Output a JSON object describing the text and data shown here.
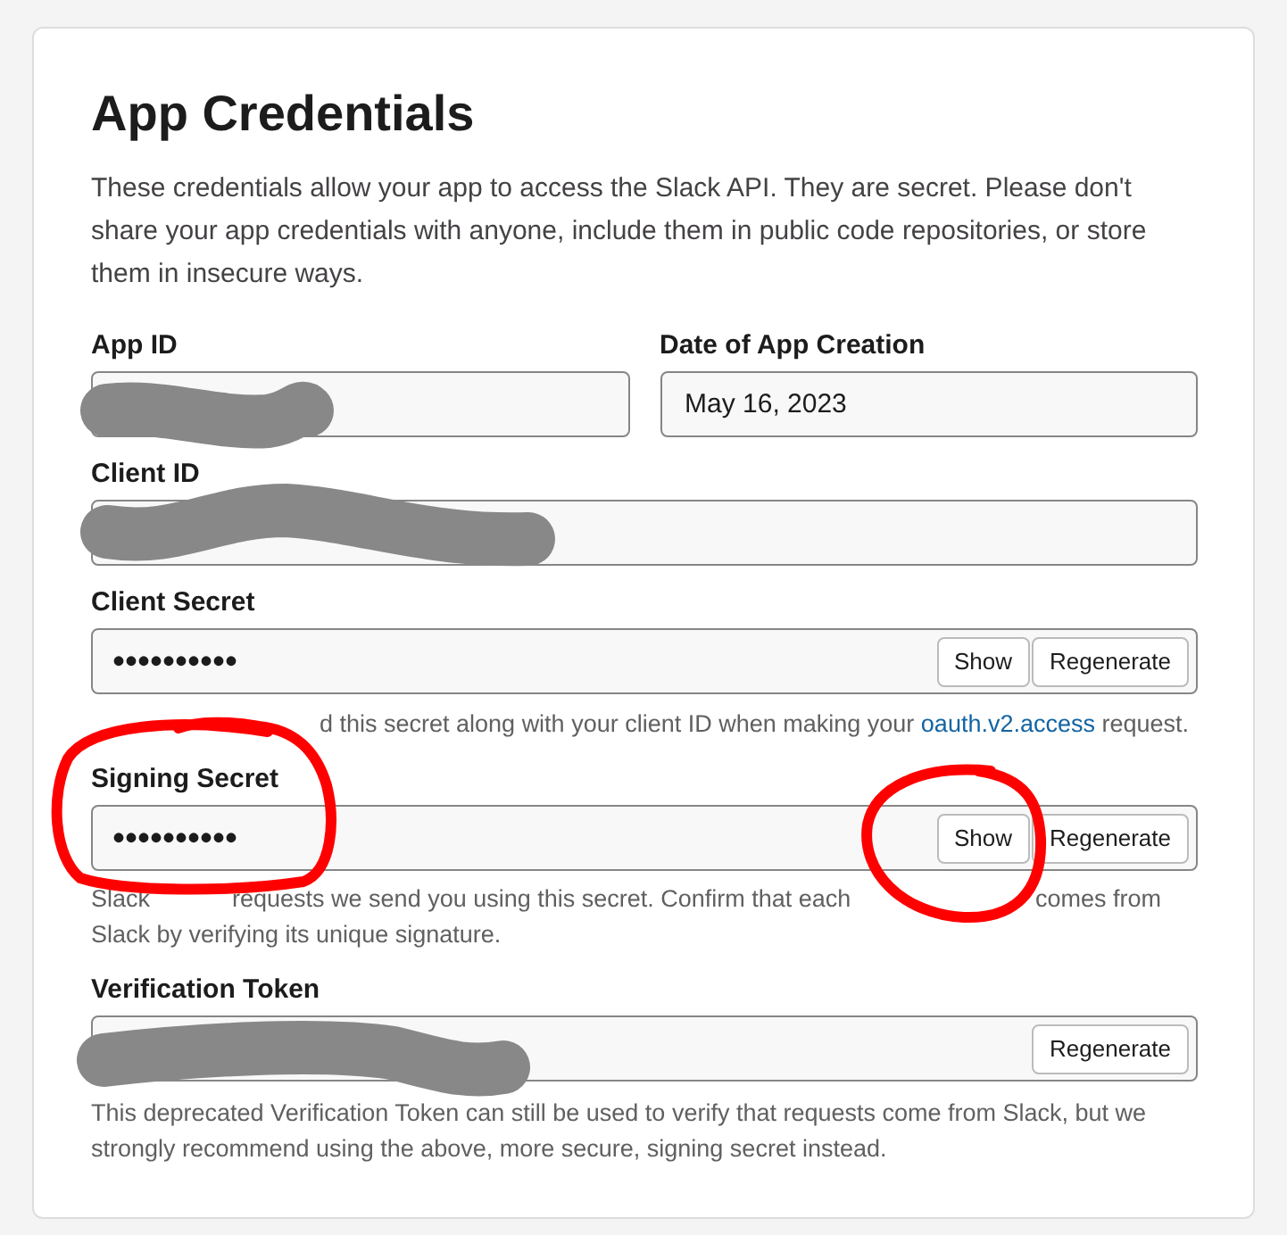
{
  "title": "App Credentials",
  "description": "These credentials allow your app to access the Slack API. They are secret. Please don't share your app credentials with anyone, include them in public code repositories, or store them in insecure ways.",
  "fields": [
    {
      "label": "App ID",
      "kind": "redacted"
    },
    {
      "label": "Date of App Creation",
      "kind": "text",
      "value": "May 16, 2023"
    },
    {
      "label": "Client ID",
      "kind": "redacted"
    },
    {
      "label": "Client Secret",
      "kind": "secret",
      "value": "••••••••••",
      "buttons": [
        "Show",
        "Regenerate"
      ],
      "help": [
        [
          {
            "text": "d this secret along with your client ID when making your ",
            "kind": "text"
          },
          {
            "text": "oauth.v2.access",
            "kind": "link"
          },
          {
            "text": " request.",
            "kind": "text"
          }
        ]
      ]
    },
    {
      "label": "Signing Secret",
      "kind": "secret",
      "value": "••••••••••",
      "buttons": [
        "Show",
        "Regenerate"
      ],
      "help": [
        [
          {
            "text": "Slack",
            "kind": "text"
          },
          {
            "text": "requests we send you using this secret. Confirm that each",
            "kind": "text"
          },
          {
            "text": "comes from",
            "kind": "text"
          }
        ],
        [
          {
            "text": "Slack by verifying its unique signature.",
            "kind": "text"
          }
        ]
      ]
    },
    {
      "label": "Verification Token",
      "kind": "redacted",
      "buttons": [
        "Regenerate"
      ],
      "help": [
        [
          {
            "text": "This deprecated Verification Token can still be used to verify that requests come from Slack, but we strongly recommend using the above, more secure, signing secret instead.",
            "kind": "text"
          }
        ]
      ]
    }
  ]
}
